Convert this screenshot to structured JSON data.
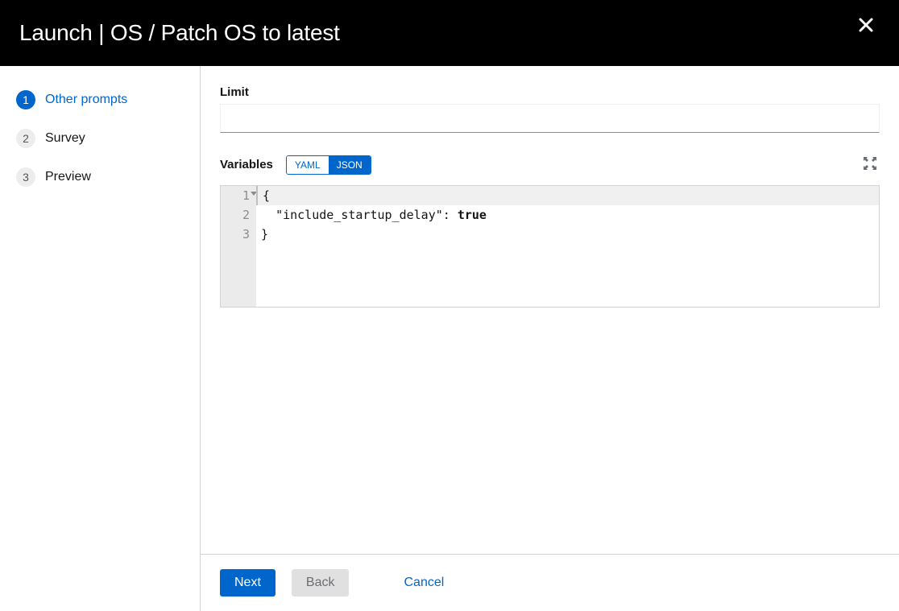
{
  "header": {
    "title": "Launch | OS / Patch OS to latest"
  },
  "steps": [
    {
      "num": "1",
      "label": "Other prompts",
      "active": true
    },
    {
      "num": "2",
      "label": "Survey",
      "active": false
    },
    {
      "num": "3",
      "label": "Preview",
      "active": false
    }
  ],
  "form": {
    "limit_label": "Limit",
    "limit_value": "",
    "variables_label": "Variables",
    "format_toggle": {
      "yaml": "YAML",
      "json": "JSON",
      "active": "JSON"
    },
    "code_lines": [
      "{",
      "  \"include_startup_delay\": true",
      "}"
    ]
  },
  "footer": {
    "next": "Next",
    "back": "Back",
    "cancel": "Cancel"
  }
}
